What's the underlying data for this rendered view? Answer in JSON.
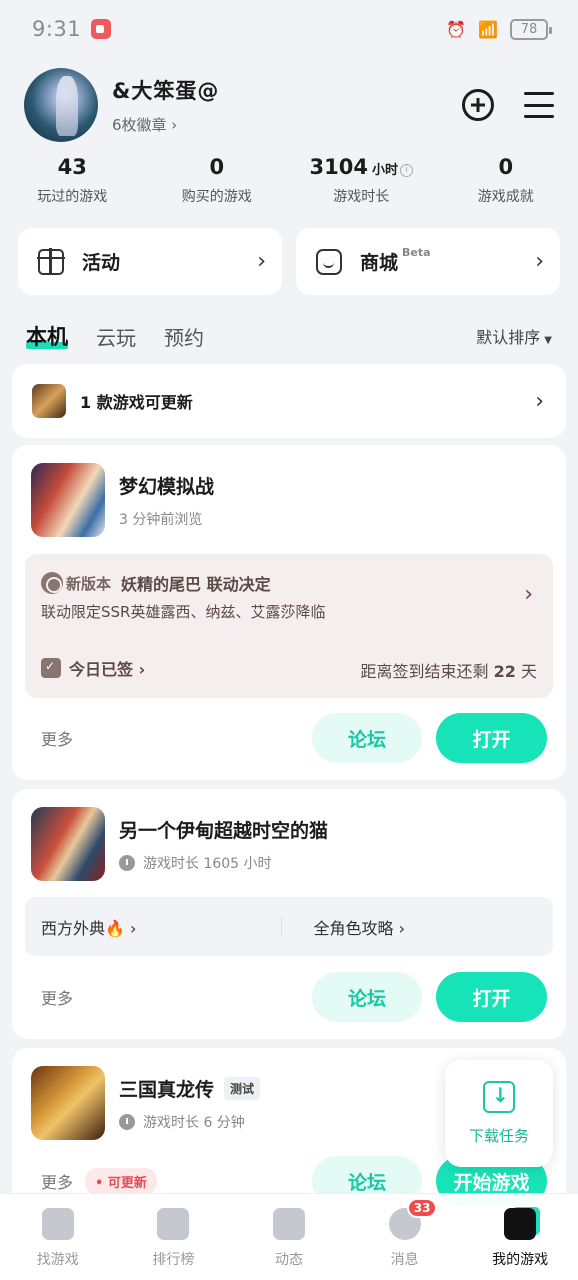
{
  "status": {
    "time": "9:31",
    "battery": "78"
  },
  "profile": {
    "username": "&大笨蛋@",
    "badges": "6枚徽章 ›"
  },
  "stats": [
    {
      "value": "43",
      "unit": "",
      "label": "玩过的游戏"
    },
    {
      "value": "0",
      "unit": "",
      "label": "购买的游戏"
    },
    {
      "value": "3104",
      "unit": "小时",
      "label": "游戏时长"
    },
    {
      "value": "0",
      "unit": "",
      "label": "游戏成就"
    }
  ],
  "quick": {
    "activity": "活动",
    "shop": "商城",
    "beta": "Beta"
  },
  "tabs": {
    "local": "本机",
    "cloud": "云玩",
    "reserve": "预约",
    "sort": "默认排序"
  },
  "update_banner": "1 款游戏可更新",
  "games": [
    {
      "title": "梦幻模拟战",
      "sub": "3 分钟前浏览",
      "event": {
        "badge": "新版本",
        "title": "妖精的尾巴 联动决定",
        "desc": "联动限定SSR英雄露西、纳兹、艾露莎降临",
        "signed": "今日已签 ›",
        "countdown_prefix": "距离签到结束还剩",
        "countdown_days": "22",
        "countdown_suffix": "天"
      },
      "more": "更多",
      "forum": "论坛",
      "open": "打开"
    },
    {
      "title": "另一个伊甸超越时空的猫",
      "sub": "游戏时长 1605 小时",
      "guides": [
        "西方外典🔥 ›",
        "全角色攻略 ›"
      ],
      "more": "更多",
      "forum": "论坛",
      "open": "打开"
    },
    {
      "title": "三国真龙传",
      "badge": "测试",
      "sub": "游戏时长 6 分钟",
      "more": "更多",
      "update_tag": "• 可更新",
      "forum": "论坛",
      "open": "开始游戏"
    }
  ],
  "download": "下载任务",
  "nav": [
    {
      "label": "找游戏",
      "icon": "find-game-icon"
    },
    {
      "label": "排行榜",
      "icon": "ranking-icon"
    },
    {
      "label": "动态",
      "icon": "feed-icon"
    },
    {
      "label": "消息",
      "icon": "message-icon",
      "badge": "33"
    },
    {
      "label": "我的游戏",
      "icon": "my-games-icon"
    }
  ]
}
